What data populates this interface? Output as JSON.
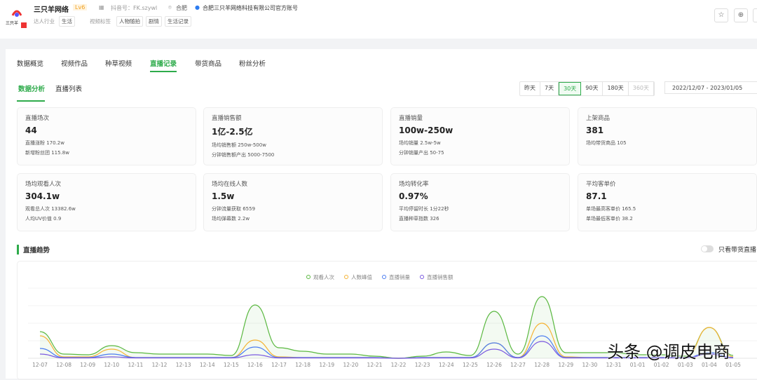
{
  "header": {
    "name": "三只羊网络",
    "level": "Lv6",
    "douyin_id": "抖音号：FK.szywl",
    "location": "合肥",
    "verified": "合肥三只羊网络科技有限公司官方账号",
    "industry_label": "达人行业",
    "industry": "生活",
    "video_tag_label": "视频标签",
    "video_tags": [
      "人物随拍",
      "剧情",
      "生活记录"
    ],
    "logo_text": "三只羊网络"
  },
  "tabs": [
    "数据概览",
    "视频作品",
    "种草视频",
    "直播记录",
    "带货商品",
    "粉丝分析"
  ],
  "subtabs": [
    "数据分析",
    "直播列表"
  ],
  "range": [
    "昨天",
    "7天",
    "30天",
    "90天",
    "180天",
    "360天"
  ],
  "date_range": "2022/12/07  - 2023/01/05",
  "cards": [
    {
      "title": "直播场次",
      "value": "44",
      "subs": [
        "直播涨粉 170.2w",
        "新增粉丝团 115.8w"
      ]
    },
    {
      "title": "直播销售额",
      "value": "1亿-2.5亿",
      "subs": [
        "场均销售额 250w-500w",
        "分钟销售额产出 5000-7500"
      ]
    },
    {
      "title": "直播销量",
      "value": "100w-250w",
      "subs": [
        "场均销量 2.5w-5w",
        "分钟销量产出 50-75"
      ]
    },
    {
      "title": "上架商品",
      "value": "381",
      "subs": [
        "场均带货商品 105",
        ""
      ]
    },
    {
      "title": "场均观看人次",
      "value": "304.1w",
      "subs": [
        "观看总人次 13382.6w",
        "人均UV价值 0.9"
      ]
    },
    {
      "title": "场均在线人数",
      "value": "1.5w",
      "subs": [
        "分钟流量获取 6559",
        "场均弹幕数 2.2w"
      ]
    },
    {
      "title": "场均转化率",
      "value": "0.97%",
      "subs": [
        "平均停留时长 1分22秒",
        "直播种草指数 326"
      ]
    },
    {
      "title": "平均客单价",
      "value": "87.1",
      "subs": [
        "单场最高客单价 165.5",
        "单场最低客单价 38.2"
      ]
    }
  ],
  "section_title": "直播趋势",
  "toggle_label": "只看带货直播",
  "watermark": "头条 @调皮电商",
  "chart_data": {
    "type": "line",
    "title": "",
    "xlabel": "",
    "ylabel": "",
    "ylim": [
      0,
      100
    ],
    "grid": true,
    "legend": "top-center",
    "categories": [
      "12-07",
      "12-08",
      "12-09",
      "12-10",
      "12-11",
      "12-12",
      "12-13",
      "12-14",
      "12-15",
      "12-16",
      "12-17",
      "12-18",
      "12-19",
      "12-20",
      "12-21",
      "12-22",
      "12-23",
      "12-24",
      "12-25",
      "12-26",
      "12-27",
      "12-28",
      "12-29",
      "12-30",
      "12-31",
      "01-01",
      "01-02",
      "01-03",
      "01-04",
      "01-05"
    ],
    "series": [
      {
        "name": "观看人次",
        "color": "#5ab840",
        "values": [
          38,
          6,
          5,
          18,
          8,
          6,
          6,
          6,
          4,
          76,
          15,
          10,
          6,
          6,
          3,
          0,
          3,
          9,
          4,
          67,
          6,
          88,
          8,
          8,
          8,
          5,
          5,
          3,
          44,
          4
        ]
      },
      {
        "name": "人数峰值",
        "color": "#f5b335",
        "values": [
          32,
          2,
          2,
          13,
          1,
          1,
          1,
          1,
          1,
          26,
          2,
          1,
          1,
          1,
          1,
          0,
          1,
          1,
          1,
          22,
          1,
          50,
          2,
          1,
          1,
          1,
          1,
          1,
          44,
          2
        ]
      },
      {
        "name": "直播销量",
        "color": "#4b7cf0",
        "values": [
          14,
          1,
          1,
          6,
          1,
          1,
          1,
          1,
          1,
          16,
          1,
          1,
          1,
          1,
          1,
          0,
          1,
          1,
          1,
          22,
          1,
          32,
          1,
          1,
          1,
          1,
          1,
          1,
          8,
          1
        ]
      },
      {
        "name": "直播销售额",
        "color": "#7b5ae0",
        "values": [
          6,
          0.5,
          0.5,
          2,
          0.5,
          0.5,
          0.5,
          0.5,
          0.5,
          5,
          0.5,
          0.5,
          0.5,
          0.5,
          0.5,
          0,
          0.5,
          0.5,
          0.5,
          13,
          0.5,
          24,
          0.5,
          0.5,
          0.5,
          0.5,
          0.5,
          0.5,
          6,
          0.5
        ]
      }
    ]
  }
}
